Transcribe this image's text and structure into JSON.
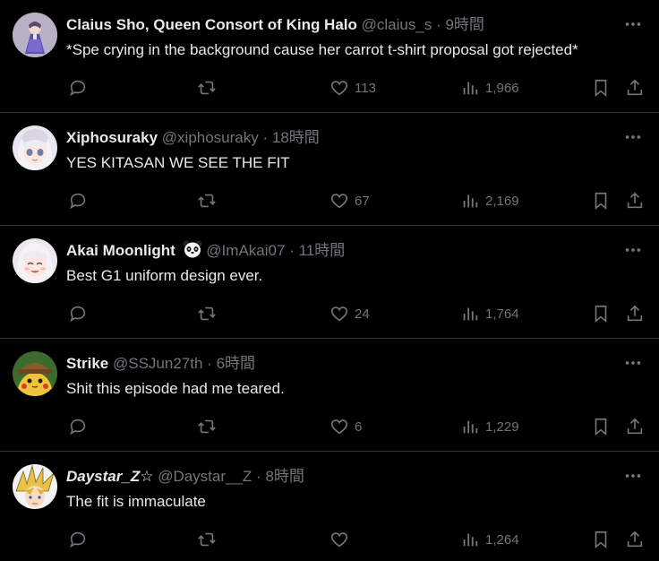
{
  "tweets": [
    {
      "name": "Claius Sho, Queen Consort of King Halo",
      "handle": "@claius_s",
      "time": "9時間",
      "text": "*Spe crying in the background cause her carrot t-shirt proposal got rejected*",
      "likes": "113",
      "views": "1,966",
      "avatar": "avatar-purple-dress",
      "italic": false
    },
    {
      "name": "Xiphosuraky",
      "handle": "@xiphosuraky",
      "time": "18時間",
      "text": "YES KITASAN WE SEE THE FIT",
      "likes": "67",
      "views": "2,169",
      "avatar": "avatar-white-hair-girl",
      "italic": false
    },
    {
      "name": "Akai Moonlight",
      "handle": "@ImAkai07",
      "time": "11時間",
      "text": "Best G1 uniform design ever.",
      "likes": "24",
      "views": "1,764",
      "avatar": "avatar-smiling-girl",
      "badge": "panda-emoji",
      "italic": false
    },
    {
      "name": "Strike",
      "handle": "@SSJun27th",
      "time": "6時間",
      "text": "Shit this episode had me teared.",
      "likes": "6",
      "views": "1,229",
      "avatar": "avatar-detective-pikachu",
      "italic": false
    },
    {
      "name": "Daystar_Z☆",
      "handle": "@Daystar__Z",
      "time": "8時間",
      "text": "The fit is immaculate",
      "likes": "",
      "views": "1,264",
      "avatar": "avatar-spiky-blond",
      "italic": true
    }
  ],
  "separator": "·",
  "colors": {
    "background": "#000000",
    "text": "#e7e9ea",
    "muted": "#71767b",
    "divider": "#2f3336"
  },
  "icons": [
    "reply-icon",
    "retweet-icon",
    "like-icon",
    "views-icon",
    "bookmark-icon",
    "share-icon",
    "more-icon"
  ]
}
